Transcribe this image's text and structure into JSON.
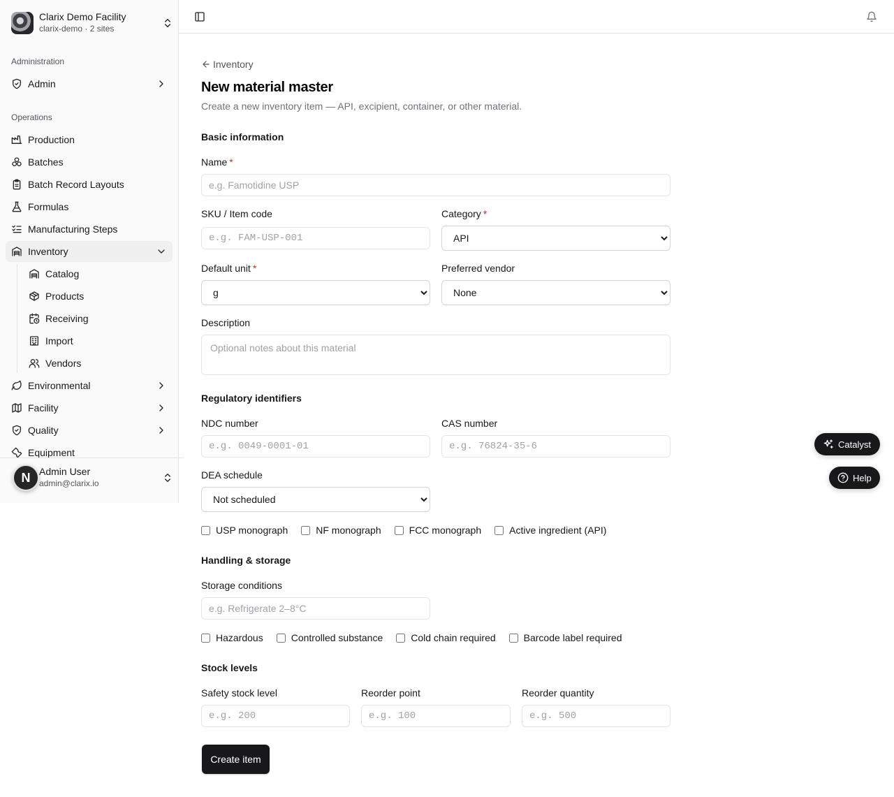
{
  "org": {
    "name": "Clarix Demo Facility",
    "slug": "clarix-demo",
    "sites": "2 sites"
  },
  "sidebar": {
    "admin_group": "Administration",
    "admin_item": "Admin",
    "ops_group": "Operations",
    "items": [
      {
        "label": "Production",
        "icon": "factory-icon"
      },
      {
        "label": "Batches",
        "icon": "boxes-icon"
      },
      {
        "label": "Batch Record Layouts",
        "icon": "clipboard-icon"
      },
      {
        "label": "Formulas",
        "icon": "flask-icon"
      },
      {
        "label": "Manufacturing Steps",
        "icon": "list-checks-icon"
      },
      {
        "label": "Inventory",
        "icon": "warehouse-icon"
      }
    ],
    "inventory_sub": [
      {
        "label": "Catalog",
        "icon": "warehouse-icon"
      },
      {
        "label": "Products",
        "icon": "package-icon"
      },
      {
        "label": "Receiving",
        "icon": "calendar-clock-icon"
      },
      {
        "label": "Import",
        "icon": "building-icon"
      },
      {
        "label": "Vendors",
        "icon": "users-icon"
      }
    ],
    "more": [
      {
        "label": "Environmental",
        "icon": "leaf-icon"
      },
      {
        "label": "Facility",
        "icon": "map-icon"
      },
      {
        "label": "Quality",
        "icon": "shield-check-icon"
      },
      {
        "label": "Equipment",
        "icon": "wrench-icon"
      }
    ]
  },
  "user": {
    "initial": "N",
    "name": "Admin User",
    "email": "admin@clarix.io"
  },
  "page": {
    "back": "Inventory",
    "title": "New material master",
    "subtitle": "Create a new inventory item — API, excipient, container, or other material."
  },
  "basic": {
    "section": "Basic information",
    "name_label": "Name",
    "name_placeholder": "e.g. Famotidine USP",
    "sku_label": "SKU / Item code",
    "sku_placeholder": "e.g. FAM-USP-001",
    "category_label": "Category",
    "category_value": "API",
    "unit_label": "Default unit",
    "unit_value": "g",
    "vendor_label": "Preferred vendor",
    "vendor_value": "None",
    "desc_label": "Description",
    "desc_placeholder": "Optional notes about this material"
  },
  "regulatory": {
    "section": "Regulatory identifiers",
    "ndc_label": "NDC number",
    "ndc_placeholder": "e.g. 0049-0001-01",
    "cas_label": "CAS number",
    "cas_placeholder": "e.g. 76824-35-6",
    "dea_label": "DEA schedule",
    "dea_value": "Not scheduled",
    "checks": [
      "USP monograph",
      "NF monograph",
      "FCC monograph",
      "Active ingredient (API)"
    ]
  },
  "handling": {
    "section": "Handling & storage",
    "storage_label": "Storage conditions",
    "storage_placeholder": "e.g. Refrigerate 2–8°C",
    "checks": [
      "Hazardous",
      "Controlled substance",
      "Cold chain required",
      "Barcode label required"
    ]
  },
  "stock": {
    "section": "Stock levels",
    "safety_label": "Safety stock level",
    "safety_placeholder": "e.g. 200",
    "reorder_point_label": "Reorder point",
    "reorder_point_placeholder": "e.g. 100",
    "reorder_qty_label": "Reorder quantity",
    "reorder_qty_placeholder": "e.g. 500"
  },
  "actions": {
    "create": "Create item"
  },
  "floating": {
    "catalyst": "Catalyst",
    "help": "Help"
  },
  "required_mark": "*",
  "colors": {
    "accent": "#18181b",
    "required": "#dc2626",
    "sidebar_bg": "#fafafa"
  }
}
